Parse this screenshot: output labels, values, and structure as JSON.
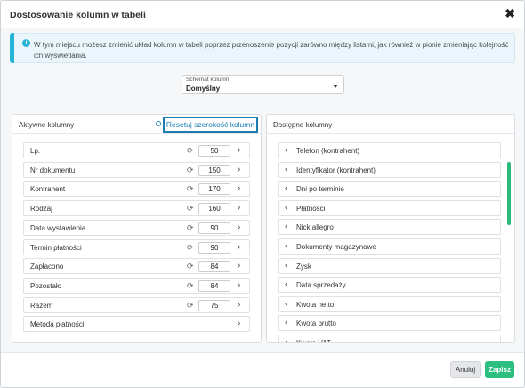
{
  "modal": {
    "title": "Dostosowanie kolumn w tabeli",
    "close_label": "✖"
  },
  "info": {
    "icon": "info-icon",
    "text": "W tym miejscu możesz zmienić układ kolumn w tabeli poprzez przenoszenie pozycji zarówno między listami, jak również w pionie zmieniając kolejność ich wyświetlania."
  },
  "schema": {
    "label": "Schemat kolumn",
    "value": "Domyślny"
  },
  "active": {
    "title": "Aktywne kolumny",
    "reset_label": "Resetuj szerokość kolumn",
    "items": [
      {
        "label": "Lp.",
        "width": "50"
      },
      {
        "label": "Nr dokumentu",
        "width": "150"
      },
      {
        "label": "Kontrahent",
        "width": "170"
      },
      {
        "label": "Rodzaj",
        "width": "160"
      },
      {
        "label": "Data wystawienia",
        "width": "90"
      },
      {
        "label": "Termin płatności",
        "width": "90"
      },
      {
        "label": "Zapłacono",
        "width": "84"
      },
      {
        "label": "Pozostało",
        "width": "84"
      },
      {
        "label": "Razem",
        "width": "75"
      },
      {
        "label": "Metoda płatności",
        "width": ""
      }
    ]
  },
  "available": {
    "title": "Dostępne kolumny",
    "items": [
      {
        "label": "Telefon (kontrahent)"
      },
      {
        "label": "Identyfikator (kontrahent)"
      },
      {
        "label": "Dni po terminie"
      },
      {
        "label": "Płatności"
      },
      {
        "label": "Nick allegro"
      },
      {
        "label": "Dokumenty magazynowe"
      },
      {
        "label": "Zysk"
      },
      {
        "label": "Data sprzedaży"
      },
      {
        "label": "Kwota netto"
      },
      {
        "label": "Kwota brutto"
      },
      {
        "label": "Kwota VAT"
      }
    ]
  },
  "footer": {
    "cancel_label": "Anuluj",
    "save_label": "Zapisz"
  },
  "colors": {
    "accent": "#1a7db3",
    "info": "#26b5d8",
    "save": "#2cbf80"
  }
}
